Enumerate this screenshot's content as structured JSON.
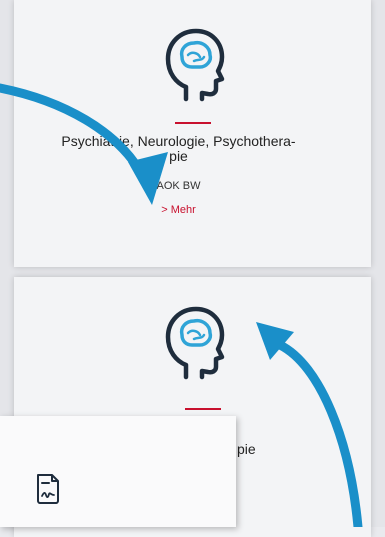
{
  "cards": [
    {
      "icon": "head-brain-icon",
      "title_line1": "Psychiatrie, Neurologie, Psychothera-",
      "title_line2": "pie",
      "subtitle": "AOK BW",
      "link": "Mehr",
      "link_icon": "chevron-right-icon"
    },
    {
      "icon": "head-brain-icon",
      "title_visible_fragment": "pie"
    }
  ],
  "popup": {
    "icon": "document-signature-icon"
  },
  "colors": {
    "accent_red": "#c8102e",
    "icon_dark": "#1f2d3d",
    "icon_blue": "#2fa4d7",
    "arrow_blue": "#1a8fc9"
  }
}
